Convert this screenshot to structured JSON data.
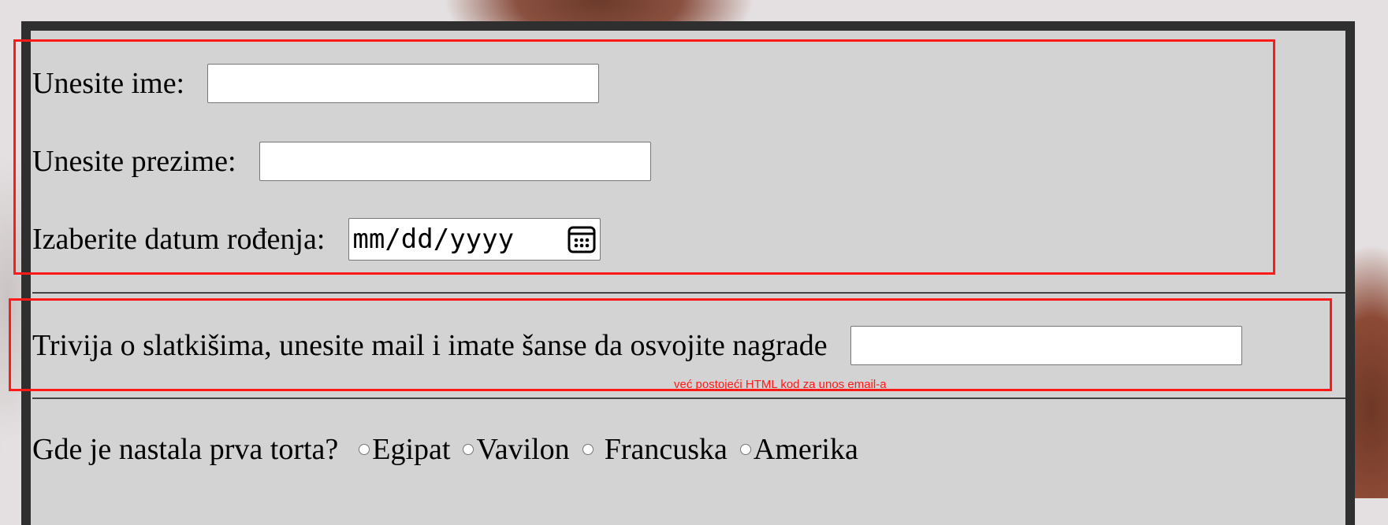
{
  "form": {
    "first_name_label": "Unesite ime:",
    "first_name_value": "",
    "last_name_label": "Unesite prezime:",
    "last_name_value": "",
    "birthdate_label": "Izaberite datum rođenja:",
    "birthdate_placeholder": "mm/dd/yyyy",
    "email_label": "Trivija o slatkišima, unesite mail i imate šanse da osvojite nagrade",
    "email_value": "",
    "annotation_note": "već postojeći HTML kod za unos email-a",
    "question_label": "Gde je nastala prva torta?",
    "options": [
      "Egipat",
      "Vavilon",
      "Francuska",
      "Amerika"
    ]
  },
  "colors": {
    "panel": "#d3d3d3",
    "panel_border": "#2f2f2f",
    "highlight": "#ff1a1a"
  },
  "icons": {
    "date_picker": "calendar-icon"
  }
}
